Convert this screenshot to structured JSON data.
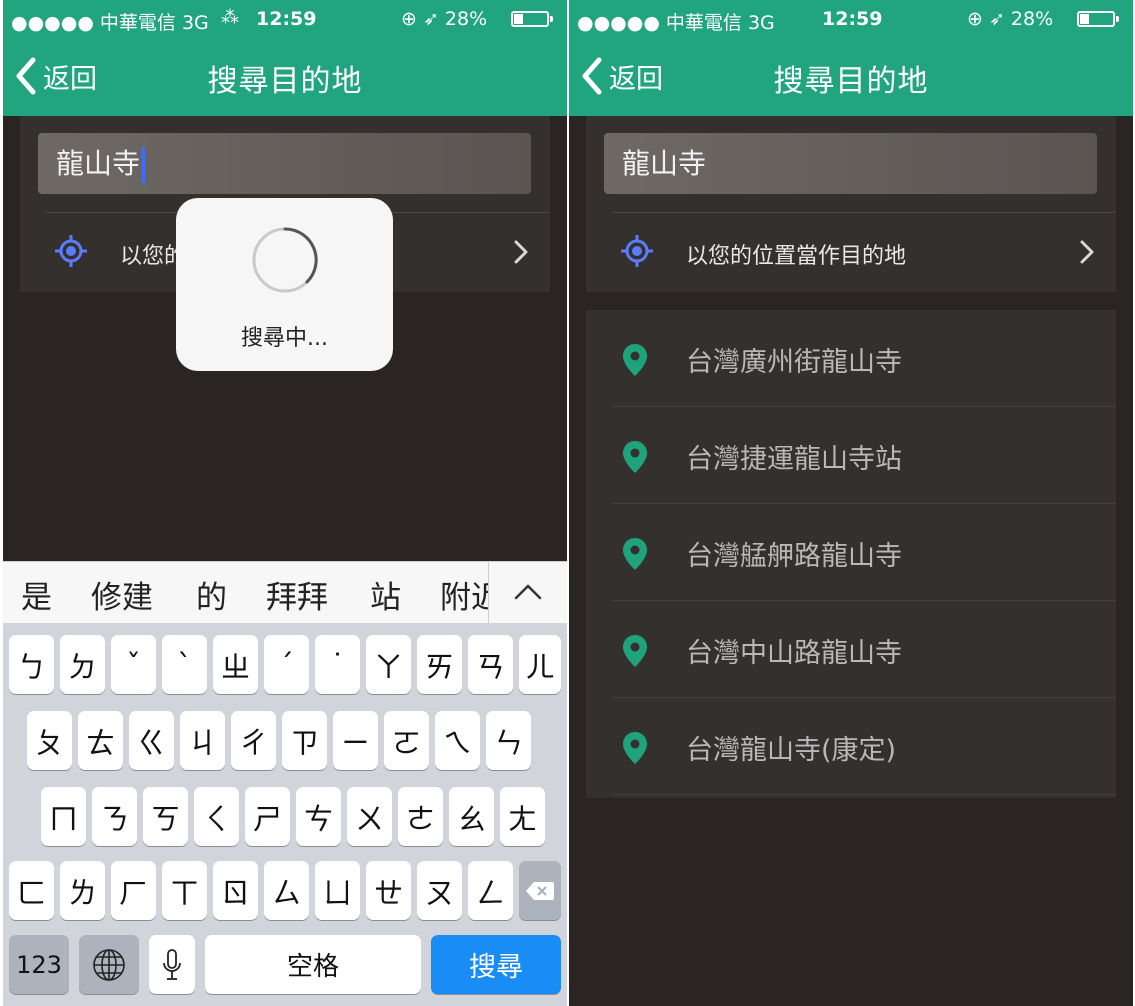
{
  "status_bar": {
    "signal": "●●●●● 中華電信 3G",
    "loading": "⁂",
    "time": "12:59",
    "right": "⊕ ➶ 28%"
  },
  "nav": {
    "back_label": "返回",
    "title": "搜尋目的地"
  },
  "search": {
    "value": "龍山寺"
  },
  "use_location": {
    "label": "以您的位置當作目的地",
    "partial_label": "以您的"
  },
  "hud": {
    "label": "搜尋中..."
  },
  "candidates": [
    "是",
    "修建",
    "的",
    "拜拜",
    "站",
    "附近"
  ],
  "keyboard": {
    "row1": [
      "ㄅ",
      "ㄉ",
      "ˇ",
      "ˋ",
      "ㄓ",
      "ˊ",
      "˙",
      "ㄚ",
      "ㄞ",
      "ㄢ",
      "ㄦ"
    ],
    "row2": [
      "ㄆ",
      "ㄊ",
      "ㄍ",
      "ㄐ",
      "ㄔ",
      "ㄗ",
      "ㄧ",
      "ㄛ",
      "ㄟ",
      "ㄣ"
    ],
    "row3": [
      "ㄇ",
      "ㄋ",
      "ㄎ",
      "ㄑ",
      "ㄕ",
      "ㄘ",
      "ㄨ",
      "ㄜ",
      "ㄠ",
      "ㄤ"
    ],
    "row4": [
      "ㄈ",
      "ㄌ",
      "ㄏ",
      "ㄒ",
      "ㄖ",
      "ㄙ",
      "ㄩ",
      "ㄝ",
      "ㄡ",
      "ㄥ"
    ],
    "numbers": "123",
    "space": "空格",
    "search": "搜尋"
  },
  "results": [
    {
      "label": "台灣廣州街龍山寺"
    },
    {
      "label": "台灣捷運龍山寺站"
    },
    {
      "label": "台灣艋舺路龍山寺"
    },
    {
      "label": "台灣中山路龍山寺"
    },
    {
      "label": "台灣龍山寺(康定)"
    }
  ],
  "colors": {
    "brand_green": "#21a57e",
    "background": "#2a2523",
    "locate_icon": "#5b7cff",
    "pin": "#1fa37c",
    "key_blue": "#1a8cf5"
  },
  "icons": {
    "back": "chevron-left-icon",
    "locate": "crosshair-icon",
    "row_chevron": "chevron-right-icon",
    "result_pin": "map-pin-icon",
    "spinner": "spinner-icon",
    "collapse": "chevron-up-icon",
    "globe": "globe-icon",
    "mic": "microphone-icon",
    "delete": "delete-icon"
  }
}
